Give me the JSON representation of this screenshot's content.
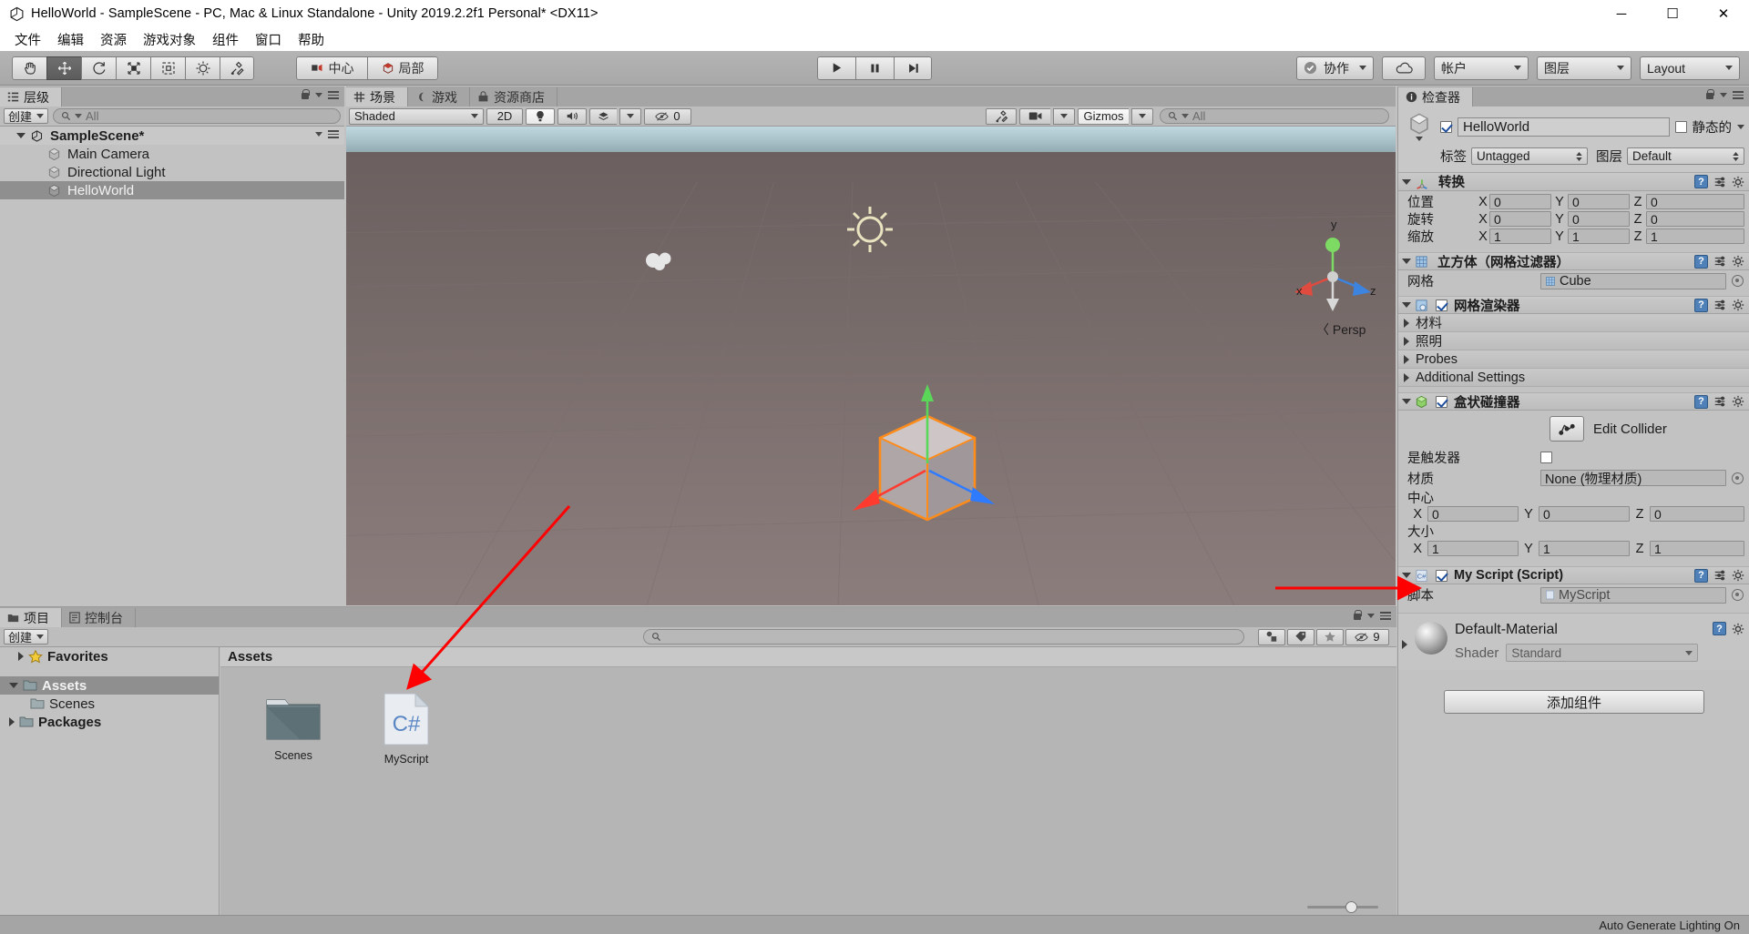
{
  "window": {
    "title": "HelloWorld - SampleScene - PC, Mac & Linux Standalone - Unity 2019.2.2f1 Personal* <DX11>",
    "minimize": "─",
    "maximize": "☐",
    "close": "✕"
  },
  "menu": {
    "items": [
      "文件",
      "编辑",
      "资源",
      "游戏对象",
      "组件",
      "窗口",
      "帮助"
    ]
  },
  "toolbar": {
    "tools": [
      {
        "name": "hand-tool",
        "glyph": "✋",
        "active": false
      },
      {
        "name": "move-tool",
        "glyph": "✥",
        "active": true
      },
      {
        "name": "rotate-tool",
        "glyph": "↻",
        "active": false
      },
      {
        "name": "scale-tool",
        "glyph": "⤡",
        "active": false
      },
      {
        "name": "rect-tool",
        "glyph": "▣",
        "active": false
      },
      {
        "name": "transform-tool",
        "glyph": "✹",
        "active": false
      },
      {
        "name": "custom-tool",
        "glyph": "⚒",
        "active": false
      }
    ],
    "pivot_mode": "中心",
    "pivot_rotation": "局部",
    "play": "▶",
    "pause": "❙❙",
    "step": "▶❙",
    "collab": "协作",
    "cloud": "cloud-icon",
    "account": "帐户",
    "layers": "图层",
    "layout": "Layout"
  },
  "hierarchy": {
    "tab": "层级",
    "create_button": "创建",
    "search_placeholder": "All",
    "scene_name": "SampleScene*",
    "objects": [
      {
        "label": "Main Camera",
        "selected": false
      },
      {
        "label": "Directional Light",
        "selected": false
      },
      {
        "label": "HelloWorld",
        "selected": true
      }
    ]
  },
  "scene": {
    "tabs": [
      {
        "label": "场景",
        "selected": true,
        "icon": "grid-icon"
      },
      {
        "label": "游戏",
        "selected": false,
        "icon": "gamepad-icon"
      },
      {
        "label": "资源商店",
        "selected": false,
        "icon": "store-icon"
      }
    ],
    "draw_mode": "Shaded",
    "mode_2d": "2D",
    "lighting_icon": "lightbulb-icon",
    "audio_icon": "speaker-icon",
    "fx_icon": "fx-icon",
    "hidden_count": "0",
    "tools_icon": "tools-icon",
    "camera_icon": "camera-icon",
    "gizmos": "Gizmos",
    "search_placeholder": "All",
    "axis_labels": {
      "x": "x",
      "y": "y",
      "z": "z"
    },
    "persp_label": "〈 Persp"
  },
  "project": {
    "tabs": [
      {
        "label": "项目",
        "selected": true,
        "icon": "folder-icon"
      },
      {
        "label": "控制台",
        "selected": false,
        "icon": "console-icon"
      }
    ],
    "create_button": "创建",
    "search_placeholder": "",
    "tree": [
      {
        "label": "Favorites",
        "icon": "star-icon",
        "depth": 0,
        "expandable": true,
        "expanded": false,
        "selected": false,
        "bold": true
      },
      {
        "label": "Assets",
        "icon": "folder-icon",
        "depth": 0,
        "expandable": true,
        "expanded": true,
        "selected": true,
        "bold": true
      },
      {
        "label": "Scenes",
        "icon": "folder-icon",
        "depth": 1,
        "expandable": false,
        "expanded": false,
        "selected": false,
        "bold": false
      },
      {
        "label": "Packages",
        "icon": "folder-icon",
        "depth": 0,
        "expandable": true,
        "expanded": false,
        "selected": false,
        "bold": true
      }
    ],
    "breadcrumb": "Assets",
    "assets": [
      {
        "label": "Scenes",
        "kind": "folder"
      },
      {
        "label": "MyScript",
        "kind": "csharp",
        "badge": "C#"
      }
    ],
    "filter_count": "9",
    "icons": [
      "type-filter-icon",
      "label-filter-icon",
      "favorite-icon",
      "hidden-icon"
    ]
  },
  "inspector": {
    "tab": "检查器",
    "object_name": "HelloWorld",
    "object_enabled": true,
    "static_label": "静态的",
    "static_checked": false,
    "tag_label": "标签",
    "tag_value": "Untagged",
    "layer_label": "图层",
    "layer_value": "Default",
    "transform": {
      "title": "转换",
      "rows": [
        {
          "label": "位置",
          "x": "0",
          "y": "0",
          "z": "0"
        },
        {
          "label": "旋转",
          "x": "0",
          "y": "0",
          "z": "0"
        },
        {
          "label": "缩放",
          "x": "1",
          "y": "1",
          "z": "1"
        }
      ]
    },
    "mesh_filter": {
      "title": "立方体（网格过滤器）",
      "mesh_label": "网格",
      "mesh_value": "Cube"
    },
    "mesh_renderer": {
      "title": "网格渲染器",
      "enabled": true,
      "sections": [
        "材料",
        "照明",
        "Probes",
        "Additional Settings"
      ]
    },
    "box_collider": {
      "title": "盒状碰撞器",
      "enabled": true,
      "edit_collider": "Edit Collider",
      "is_trigger_label": "是触发器",
      "is_trigger_checked": false,
      "material_label": "材质",
      "material_value": "None (物理材质)",
      "center_label": "中心",
      "center": {
        "x": "0",
        "y": "0",
        "z": "0"
      },
      "size_label": "大小",
      "size": {
        "x": "1",
        "y": "1",
        "z": "1"
      }
    },
    "script_component": {
      "title": "My Script (Script)",
      "enabled": true,
      "script_label": "脚本",
      "script_value": "MyScript"
    },
    "material_preview": {
      "name": "Default-Material",
      "shader_label": "Shader",
      "shader_value": "Standard"
    },
    "add_component": "添加组件"
  },
  "statusbar": {
    "text": "Auto Generate Lighting On"
  },
  "colors": {
    "accent_selection": "#8f8f8f",
    "panel_bg": "#c2c2c2",
    "toolbar_bg": "#a8a8a8",
    "annotation_arrow": "#ff0000",
    "cube_outline": "#ff8c1a",
    "axis_x": "#ff3b30",
    "axis_y": "#5ad659",
    "axis_z": "#2f7bff"
  }
}
